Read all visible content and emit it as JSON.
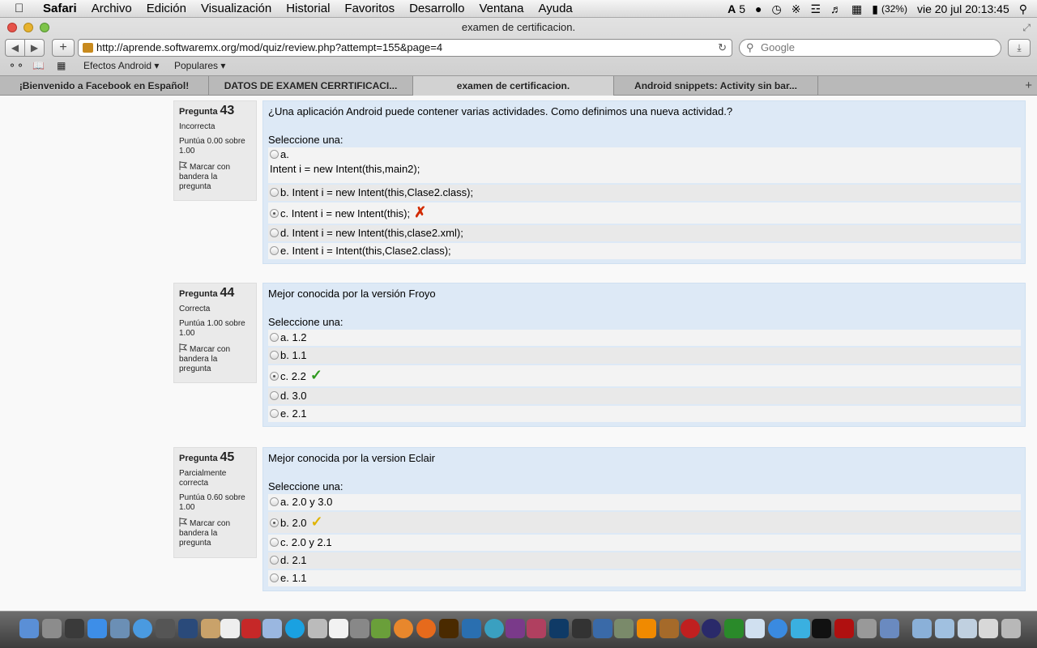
{
  "menubar": {
    "app": "Safari",
    "items": [
      "Archivo",
      "Edición",
      "Visualización",
      "Historial",
      "Favoritos",
      "Desarrollo",
      "Ventana",
      "Ayuda"
    ],
    "adobe_count": "5",
    "battery": "(32%)",
    "date": "vie 20 jul",
    "time": "20:13:45"
  },
  "window": {
    "title": "examen de certificacion."
  },
  "navbar": {
    "url": "http://aprende.softwaremx.org/mod/quiz/review.php?attempt=155&page=4",
    "search_placeholder": "Google"
  },
  "bookmarks": [
    "Efectos Android ▾",
    "Populares ▾"
  ],
  "tabs": [
    {
      "label": "¡Bienvenido a Facebook en Español!"
    },
    {
      "label": "DATOS DE EXAMEN CERRTIFICACI..."
    },
    {
      "label": "examen de certificacion."
    },
    {
      "label": "Android snippets: Activity sin bar..."
    }
  ],
  "questions": [
    {
      "label": "Pregunta",
      "number": "43",
      "state": "Incorrecta",
      "score": "Puntúa 0.00 sobre 1.00",
      "flag": "Marcar con bandera la pregunta",
      "text": "¿Una aplicación Android puede contener varias actividades. Como definimos una nueva actividad.?",
      "select": "Seleccione una:",
      "options": [
        {
          "letter": "a.",
          "text": "Intent i = new Intent(this,main2);"
        },
        {
          "letter": "b.",
          "text": "Intent i = new Intent(this,Clase2.class);"
        },
        {
          "letter": "c.",
          "text": "Intent i = new Intent(this);",
          "selected": true,
          "mark": "✗"
        },
        {
          "letter": "d.",
          "text": "Intent i = new Intent(this,clase2.xml);"
        },
        {
          "letter": "e.",
          "text": "Intent i = Intent(this,Clase2.class);"
        }
      ]
    },
    {
      "label": "Pregunta",
      "number": "44",
      "state": "Correcta",
      "score": "Puntúa 1.00 sobre 1.00",
      "flag": "Marcar con bandera la pregunta",
      "text": "Mejor conocida por la versión Froyo",
      "select": "Seleccione una:",
      "options": [
        {
          "letter": "a.",
          "text": "1.2"
        },
        {
          "letter": "b.",
          "text": "1.1"
        },
        {
          "letter": "c.",
          "text": "2.2",
          "selected": true,
          "mark": "✓"
        },
        {
          "letter": "d.",
          "text": "3.0"
        },
        {
          "letter": "e.",
          "text": "2.1"
        }
      ]
    },
    {
      "label": "Pregunta",
      "number": "45",
      "state": "Parcialmente correcta",
      "score": "Puntúa 0.60 sobre 1.00",
      "flag": "Marcar con bandera la pregunta",
      "text": "Mejor conocida por la version Eclair",
      "select": "Seleccione una:",
      "options": [
        {
          "letter": "a.",
          "text": "2.0 y 3.0"
        },
        {
          "letter": "b.",
          "text": "2.0",
          "selected": true,
          "mark": "✓"
        },
        {
          "letter": "c.",
          "text": "2.0 y 2.1"
        },
        {
          "letter": "d.",
          "text": "2.1"
        },
        {
          "letter": "e.",
          "text": "1.1"
        }
      ]
    }
  ],
  "colors": {
    "incorrect": "#d22a00",
    "correct": "#2e9a1e",
    "partial": "#e0b400",
    "question_bg": "#dde9f6"
  }
}
